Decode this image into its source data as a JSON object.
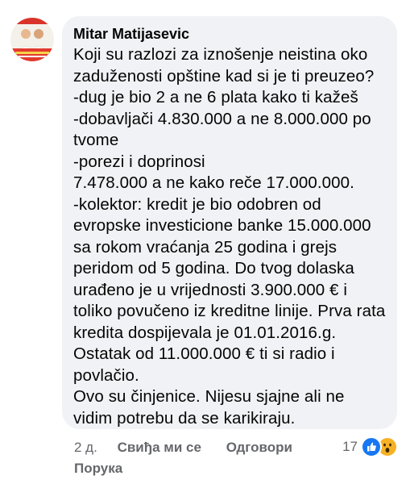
{
  "comment": {
    "author": "Mitar Matijasevic",
    "lines": [
      "Koji su razlozi za iznošenje neistina oko",
      "zaduženosti opštine kad si je ti preuzeo?",
      "-dug je bio 2 a ne 6 plata kako ti kažeš",
      "-dobavljači 4.830.000 a ne 8.000.000 po",
      "tvome",
      "-porezi i doprinosi",
      "7.478.000 a ne kako reče 17.000.000.",
      "-kolektor: kredit je bio odobren od",
      "evropske investicione banke 15.000.000",
      "sa rokom vraćanja 25 godina i grejs",
      "peridom od 5 godina. Do tvog dolaska",
      "urađeno je u vrijednosti 3.900.000 € i",
      "toliko povučeno iz kreditne linije. Prva rata",
      "kredita dospijevala je 01.01.2016.g.",
      "Ostatak od 11.000.000 € ti si radio i",
      "povlačio.",
      "Ovo su činjenice. Nijesu sjajne ali ne",
      "vidim potrebu da se karikiraju."
    ]
  },
  "actions": {
    "time": "2 д.",
    "like": "Свиђа ми се",
    "reply": "Одговори",
    "message": "Порука"
  },
  "reactions": {
    "count": "17",
    "icons": [
      "like-icon",
      "wow-icon"
    ],
    "colors": {
      "like": "#1877f2",
      "wow": "#f7b125"
    }
  },
  "colors": {
    "bubble": "#f0f2f5",
    "text": "#050505",
    "secondary": "#65676b"
  }
}
